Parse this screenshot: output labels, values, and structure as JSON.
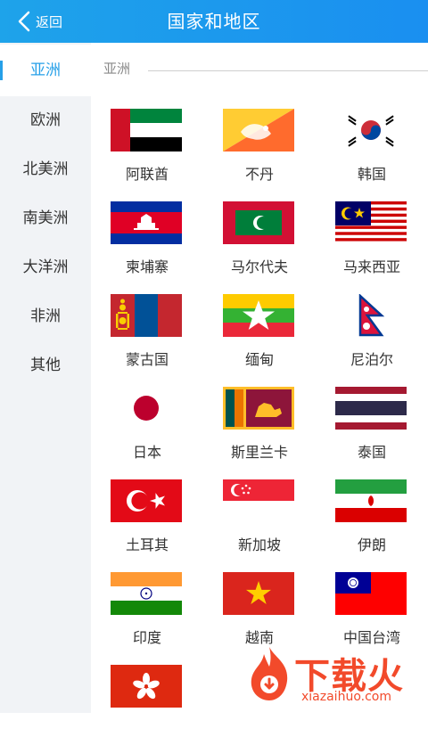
{
  "header": {
    "back_label": "返回",
    "title": "国家和地区"
  },
  "sidebar": {
    "items": [
      {
        "label": "亚洲",
        "active": true
      },
      {
        "label": "欧洲"
      },
      {
        "label": "北美洲"
      },
      {
        "label": "南美洲"
      },
      {
        "label": "大洋洲"
      },
      {
        "label": "非洲"
      },
      {
        "label": "其他"
      }
    ]
  },
  "main": {
    "section_title": "亚洲",
    "countries": [
      {
        "name": "阿联酋",
        "flag": "uae-flag"
      },
      {
        "name": "不丹",
        "flag": "bhutan-flag"
      },
      {
        "name": "韩国",
        "flag": "south-korea-flag"
      },
      {
        "name": "柬埔寨",
        "flag": "cambodia-flag"
      },
      {
        "name": "马尔代夫",
        "flag": "maldives-flag"
      },
      {
        "name": "马来西亚",
        "flag": "malaysia-flag"
      },
      {
        "name": "蒙古国",
        "flag": "mongolia-flag"
      },
      {
        "name": "缅甸",
        "flag": "myanmar-flag"
      },
      {
        "name": "尼泊尔",
        "flag": "nepal-flag"
      },
      {
        "name": "日本",
        "flag": "japan-flag"
      },
      {
        "name": "斯里兰卡",
        "flag": "sri-lanka-flag"
      },
      {
        "name": "泰国",
        "flag": "thailand-flag"
      },
      {
        "name": "土耳其",
        "flag": "turkey-flag"
      },
      {
        "name": "新加坡",
        "flag": "singapore-flag"
      },
      {
        "name": "伊朗",
        "flag": "iran-flag"
      },
      {
        "name": "印度",
        "flag": "india-flag"
      },
      {
        "name": "越南",
        "flag": "vietnam-flag"
      },
      {
        "name": "中国台湾",
        "flag": "taiwan-flag"
      },
      {
        "name": "",
        "flag": "hong-kong-flag"
      }
    ]
  },
  "watermark": {
    "brand": "下载火",
    "domain": "xiazaihuo.com"
  }
}
